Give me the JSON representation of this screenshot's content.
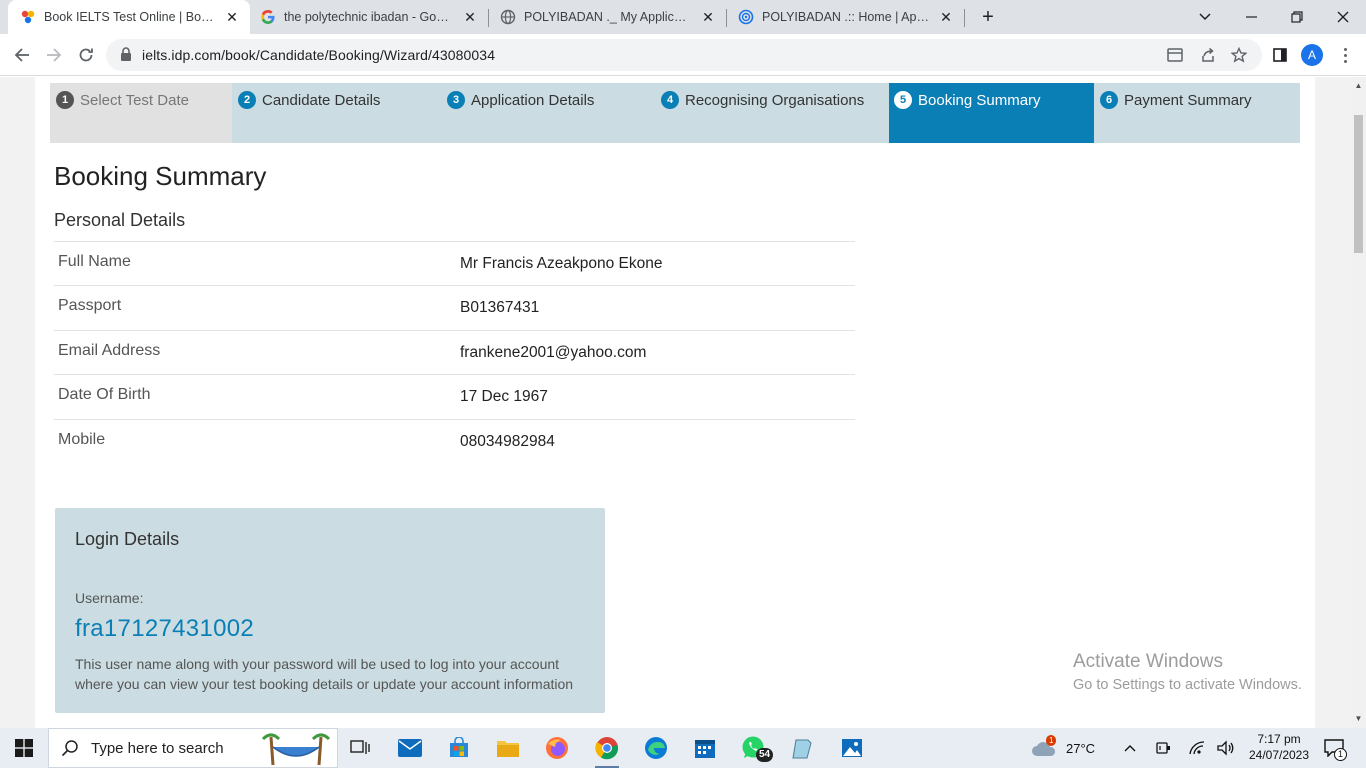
{
  "browser": {
    "tabs": [
      {
        "title": "Book IELTS Test Online | Booking",
        "active": true
      },
      {
        "title": "the polytechnic ibadan - Google",
        "active": false
      },
      {
        "title": "POLYIBADAN ._ My Application",
        "active": false
      },
      {
        "title": "POLYIBADAN .:: Home | Applicati",
        "active": false
      }
    ],
    "url": "ielts.idp.com/book/Candidate/Booking/Wizard/43080034",
    "profile_initial": "A"
  },
  "wizard": {
    "steps": [
      {
        "num": "1",
        "label": "Select Test Date"
      },
      {
        "num": "2",
        "label": "Candidate Details"
      },
      {
        "num": "3",
        "label": "Application Details"
      },
      {
        "num": "4",
        "label": "Recognising Organisations"
      },
      {
        "num": "5",
        "label": "Booking Summary"
      },
      {
        "num": "6",
        "label": "Payment Summary"
      }
    ],
    "current_step": 5
  },
  "page": {
    "title": "Booking Summary",
    "section_title": "Personal Details",
    "details": [
      {
        "label": "Full Name",
        "value": "Mr Francis Azeakpono Ekone"
      },
      {
        "label": "Passport",
        "value": "B01367431"
      },
      {
        "label": "Email Address",
        "value": "frankene2001@yahoo.com"
      },
      {
        "label": "Date Of Birth",
        "value": "17 Dec 1967"
      },
      {
        "label": "Mobile",
        "value": "08034982984"
      }
    ],
    "login": {
      "title": "Login Details",
      "username_label": "Username:",
      "username": "fra17127431002",
      "note": "This user name along with your password will be used to log into your account where you can view your test booking details or update your account information"
    }
  },
  "watermark": {
    "line1": "Activate Windows",
    "line2": "Go to Settings to activate Windows."
  },
  "taskbar": {
    "search_placeholder": "Type here to search",
    "whatsapp_badge": "54",
    "weather_badge": "1",
    "temperature": "27°C",
    "time": "7:17 pm",
    "date": "24/07/2023",
    "notification_count": "1"
  },
  "colors": {
    "accent": "#0a7fb6",
    "step_bg": "#cbdde2",
    "step_done_bg": "#e1e1e1"
  }
}
